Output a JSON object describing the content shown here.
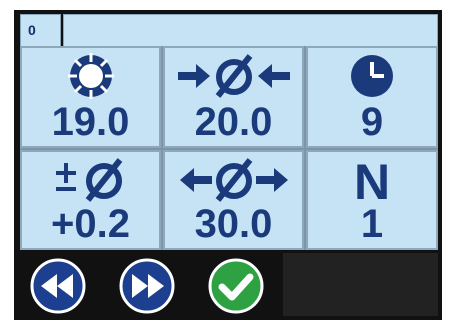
{
  "header": {
    "id_value": "0"
  },
  "cells": [
    {
      "icon": "sun-icon",
      "value": "19.0"
    },
    {
      "icon": "diameter-inward-arrows-icon",
      "value": "20.0"
    },
    {
      "icon": "clock-icon",
      "value": "9"
    },
    {
      "icon": "plus-minus-diameter-icon",
      "value": "+0.2"
    },
    {
      "icon": "diameter-outward-arrows-icon",
      "value": "30.0"
    },
    {
      "label": "N",
      "value": "1"
    }
  ],
  "toolbar": {
    "rewind_icon": "rewind-icon",
    "fast_forward_icon": "fast-forward-icon",
    "confirm_icon": "check-icon"
  },
  "colors": {
    "panel": "#c6e3f6",
    "text": "#1a3a7b",
    "button_blue": "#1c3f8f",
    "button_green": "#2ea143",
    "screen_bg": "#111111"
  }
}
